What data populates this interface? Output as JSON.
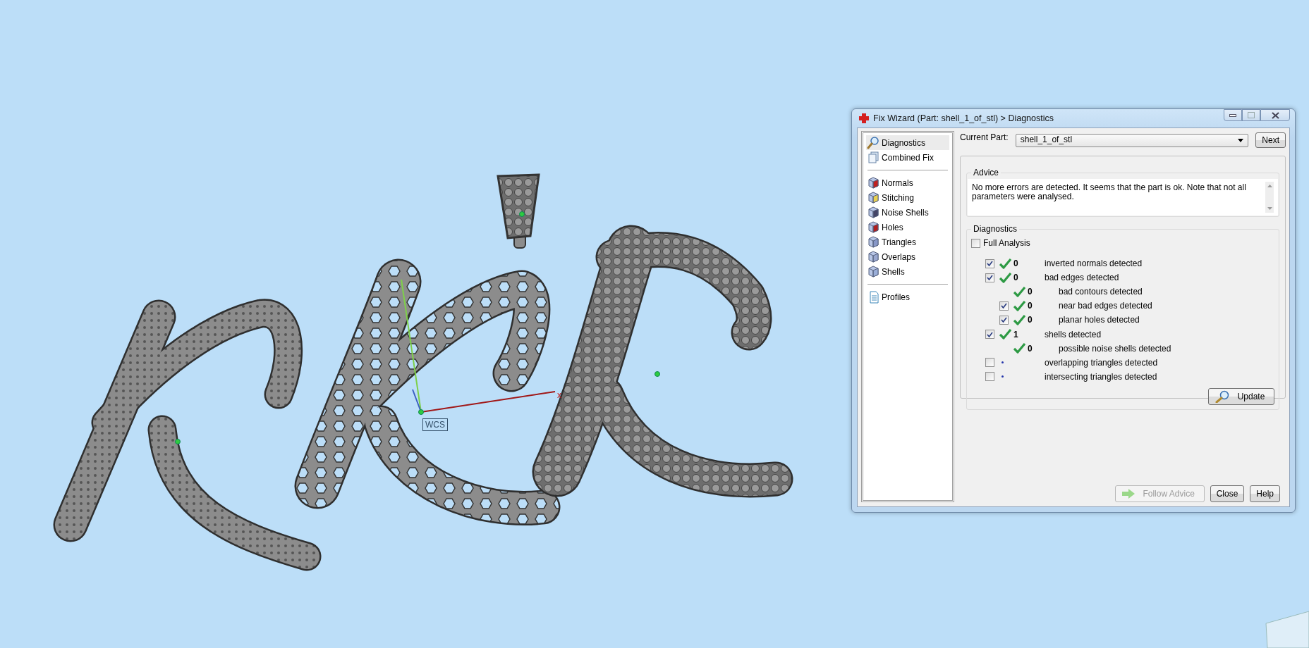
{
  "viewport": {
    "axis_label": "x",
    "wcs_label": "WCS"
  },
  "dialog": {
    "title": "Fix Wizard (Part: shell_1_of_stl) > Diagnostics",
    "sidebar": {
      "groups": [
        [
          {
            "label": "Diagnostics",
            "selected": true
          },
          {
            "label": "Combined Fix",
            "selected": false
          }
        ],
        [
          {
            "label": "Normals",
            "selected": false
          },
          {
            "label": "Stitching",
            "selected": false
          },
          {
            "label": "Noise Shells",
            "selected": false
          },
          {
            "label": "Holes",
            "selected": false
          },
          {
            "label": "Triangles",
            "selected": false
          },
          {
            "label": "Overlaps",
            "selected": false
          },
          {
            "label": "Shells",
            "selected": false
          }
        ],
        [
          {
            "label": "Profiles",
            "selected": false
          }
        ]
      ]
    },
    "current_part_label": "Current Part:",
    "current_part": "shell_1_of_stl",
    "next_button": "Next",
    "advice": {
      "legend": "Advice",
      "text": "No more errors are detected. It seems that the part is ok. Note that not all parameters were analysed."
    },
    "diagnostics": {
      "legend": "Diagnostics",
      "full_analysis": {
        "label": "Full Analysis",
        "checked": false
      },
      "rows": [
        {
          "kind": "check",
          "checked": true,
          "passed": true,
          "count": "0",
          "label": "inverted normals detected"
        },
        {
          "kind": "check",
          "checked": true,
          "passed": true,
          "count": "0",
          "label": "bad edges detected",
          "children": [
            {
              "kind": "plain",
              "passed": true,
              "count": "0",
              "label": "bad contours detected"
            },
            {
              "kind": "check",
              "checked": true,
              "passed": true,
              "count": "0",
              "label": "near bad edges detected"
            },
            {
              "kind": "check",
              "checked": true,
              "passed": true,
              "count": "0",
              "label": "planar holes detected"
            }
          ]
        },
        {
          "kind": "check",
          "checked": true,
          "passed": true,
          "count": "1",
          "label": "shells detected",
          "children": [
            {
              "kind": "plain",
              "passed": true,
              "count": "0",
              "label": "possible noise shells detected"
            }
          ]
        },
        {
          "kind": "check",
          "checked": false,
          "passed": false,
          "label": "overlapping triangles detected"
        },
        {
          "kind": "check",
          "checked": false,
          "passed": false,
          "label": "intersecting triangles detected"
        }
      ]
    },
    "update_button": "Update",
    "buttons": [
      {
        "label": "Follow Advice",
        "disabled": true
      },
      {
        "label": "Close",
        "disabled": false
      },
      {
        "label": "Help",
        "disabled": false
      }
    ]
  }
}
